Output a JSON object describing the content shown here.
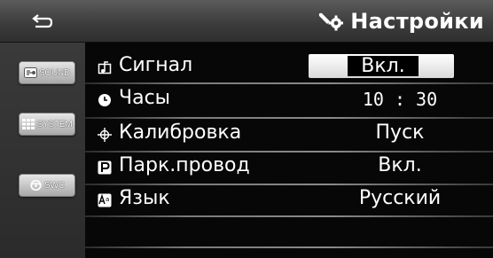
{
  "header": {
    "title": "Настройки",
    "title_icon": "wrench-gear-icon",
    "back_icon": "back-arrow-icon"
  },
  "sidebar": {
    "items": [
      {
        "label": "SOUND",
        "icon": "sound-icon"
      },
      {
        "label": "SYSTEM",
        "icon": "grid-icon"
      },
      {
        "label": "SWC",
        "icon": "steering-wheel-icon"
      }
    ]
  },
  "settings": {
    "rows": [
      {
        "label": "Сигнал",
        "value": "Вкл.",
        "icon": "beep-note-icon"
      },
      {
        "label": "Часы",
        "value": "10 : 30",
        "icon": "clock-icon"
      },
      {
        "label": "Калибровка",
        "value": "Пуск",
        "icon": "crosshair-icon"
      },
      {
        "label": "Парк.провод",
        "value": "Вкл.",
        "icon": "parking-icon"
      },
      {
        "label": "Язык",
        "value": "Русский",
        "icon": "language-icon"
      }
    ]
  },
  "colors": {
    "bar_top": "#5b5b5b",
    "bar_bottom": "#2f2f2f",
    "background": "#070707",
    "text": "#ffffff",
    "button_light": "#e6e6e6"
  }
}
